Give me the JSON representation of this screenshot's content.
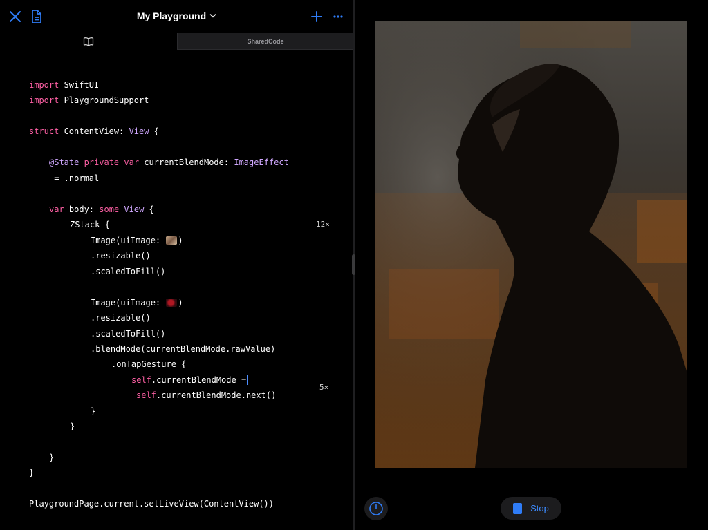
{
  "colors": {
    "accent": "#2f7cf6",
    "keyword": "#fc5fa3",
    "type": "#d0a8ff",
    "background": "#000000",
    "tab_inactive": "#1d1d1f"
  },
  "toolbar": {
    "close_icon": "close-icon",
    "document_icon": "document-icon",
    "title": "My Playground",
    "title_icon": "chevron-down-icon",
    "add_icon": "plus-icon",
    "more_icon": "more-icon"
  },
  "tabs": {
    "book_icon": "book-icon",
    "shared_label": "SharedCode"
  },
  "code": {
    "l1_kw": "import",
    "l1_rest": " SwiftUI",
    "l2_kw": "import",
    "l2_rest": " PlaygroundSupport",
    "l3_kw": "struct",
    "l3_mid": " ContentView: ",
    "l3_ty": "View",
    "l3_end": " {",
    "l4_attr": "@State",
    "l4_kw": " private var",
    "l4_mid": " currentBlendMode: ",
    "l4_ty": "ImageEffect",
    "l5": " = .normal",
    "l6_kw": "var",
    "l6_mid": " body: ",
    "l6_kw2": "some",
    "l6_ty": " View",
    "l6_end": " {",
    "l7": "ZStack {",
    "l8_a": "Image(uiImage: ",
    "l8_b": ")",
    "l9": ".resizable()",
    "l10": ".scaledToFill()",
    "l11_a": "Image(uiImage: ",
    "l11_b": ")",
    "l12": ".resizable()",
    "l13": ".scaledToFill()",
    "l14": ".blendMode(currentBlendMode.rawValue)",
    "l15": ".onTapGesture {",
    "l16_kw": "self",
    "l16_rest": ".currentBlendMode =",
    "l17_kw": "self",
    "l17_rest": ".currentBlendMode.next()",
    "l18": "}",
    "l19": "}",
    "l20": "}",
    "l21": "}",
    "l22": "PlaygroundPage.current.setLiveView(ContentView())"
  },
  "badges": {
    "zstack_count": "12×",
    "tap_count": "5×"
  },
  "live_view": {
    "photo_description_icon": "portrait-image",
    "speed_icon": "speedometer-icon",
    "stop_label": "Stop",
    "stop_icon": "stop-icon"
  }
}
